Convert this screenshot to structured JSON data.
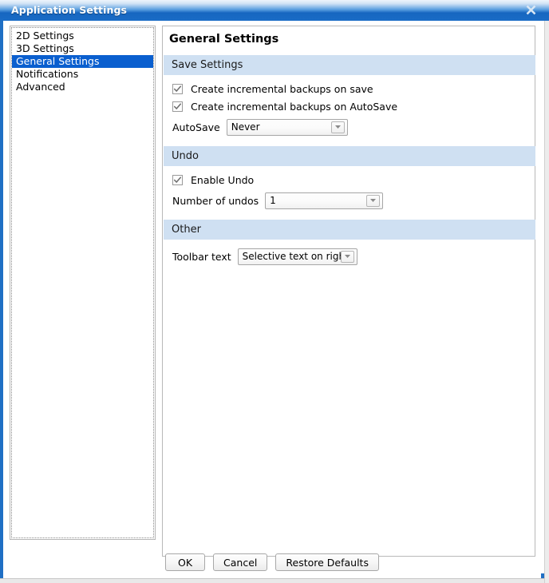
{
  "window": {
    "title": "Application Settings",
    "close_icon": "close-icon"
  },
  "sidebar": {
    "items": [
      {
        "label": "2D Settings",
        "selected": false
      },
      {
        "label": "3D Settings",
        "selected": false
      },
      {
        "label": "General Settings",
        "selected": true
      },
      {
        "label": "Notifications",
        "selected": false
      },
      {
        "label": "Advanced",
        "selected": false
      }
    ]
  },
  "panel": {
    "title": "General Settings",
    "sections": {
      "save": {
        "header": "Save Settings",
        "checkbox_backup_save": {
          "label": "Create incremental backups on save",
          "checked": true
        },
        "checkbox_backup_autosave": {
          "label": "Create incremental backups on AutoSave",
          "checked": true
        },
        "autosave": {
          "label": "AutoSave",
          "value": "Never"
        }
      },
      "undo": {
        "header": "Undo",
        "checkbox_enable_undo": {
          "label": "Enable Undo",
          "checked": true
        },
        "number_of_undos": {
          "label": "Number of undos",
          "value": "1"
        }
      },
      "other": {
        "header": "Other",
        "toolbar_text": {
          "label": "Toolbar text",
          "value": "Selective text on right"
        }
      }
    }
  },
  "footer": {
    "ok": "OK",
    "cancel": "Cancel",
    "restore_defaults": "Restore Defaults"
  },
  "colors": {
    "titlebar_blue": "#1666c0",
    "frame_blue": "#1f6fc4",
    "section_header_blue": "#cfe0f2",
    "selection_blue": "#0a5fcf"
  }
}
